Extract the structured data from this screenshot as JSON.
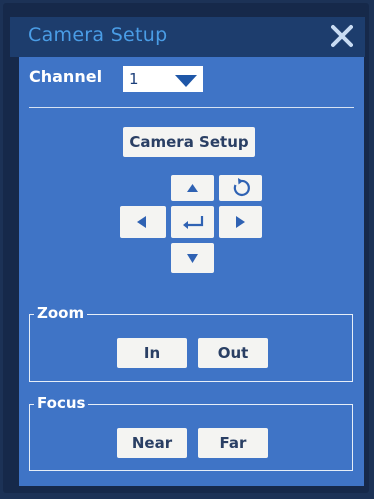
{
  "window": {
    "title": "Camera Setup",
    "close_icon": "close-icon"
  },
  "channel": {
    "label": "Channel",
    "selected": "1"
  },
  "setup_button": {
    "label": "Camera Setup"
  },
  "ptz": {
    "up_icon": "arrow-up-icon",
    "down_icon": "arrow-down-icon",
    "left_icon": "arrow-left-icon",
    "right_icon": "arrow-right-icon",
    "enter_icon": "enter-icon",
    "rotate_icon": "rotate-icon"
  },
  "zoom": {
    "label": "Zoom",
    "in_label": "In",
    "out_label": "Out"
  },
  "focus": {
    "label": "Focus",
    "near_label": "Near",
    "far_label": "Far"
  },
  "colors": {
    "panel": "#3f74c6",
    "titlebar": "#1d3d6d",
    "title_text": "#4a9de6",
    "button_bg": "#f4f4f2"
  }
}
